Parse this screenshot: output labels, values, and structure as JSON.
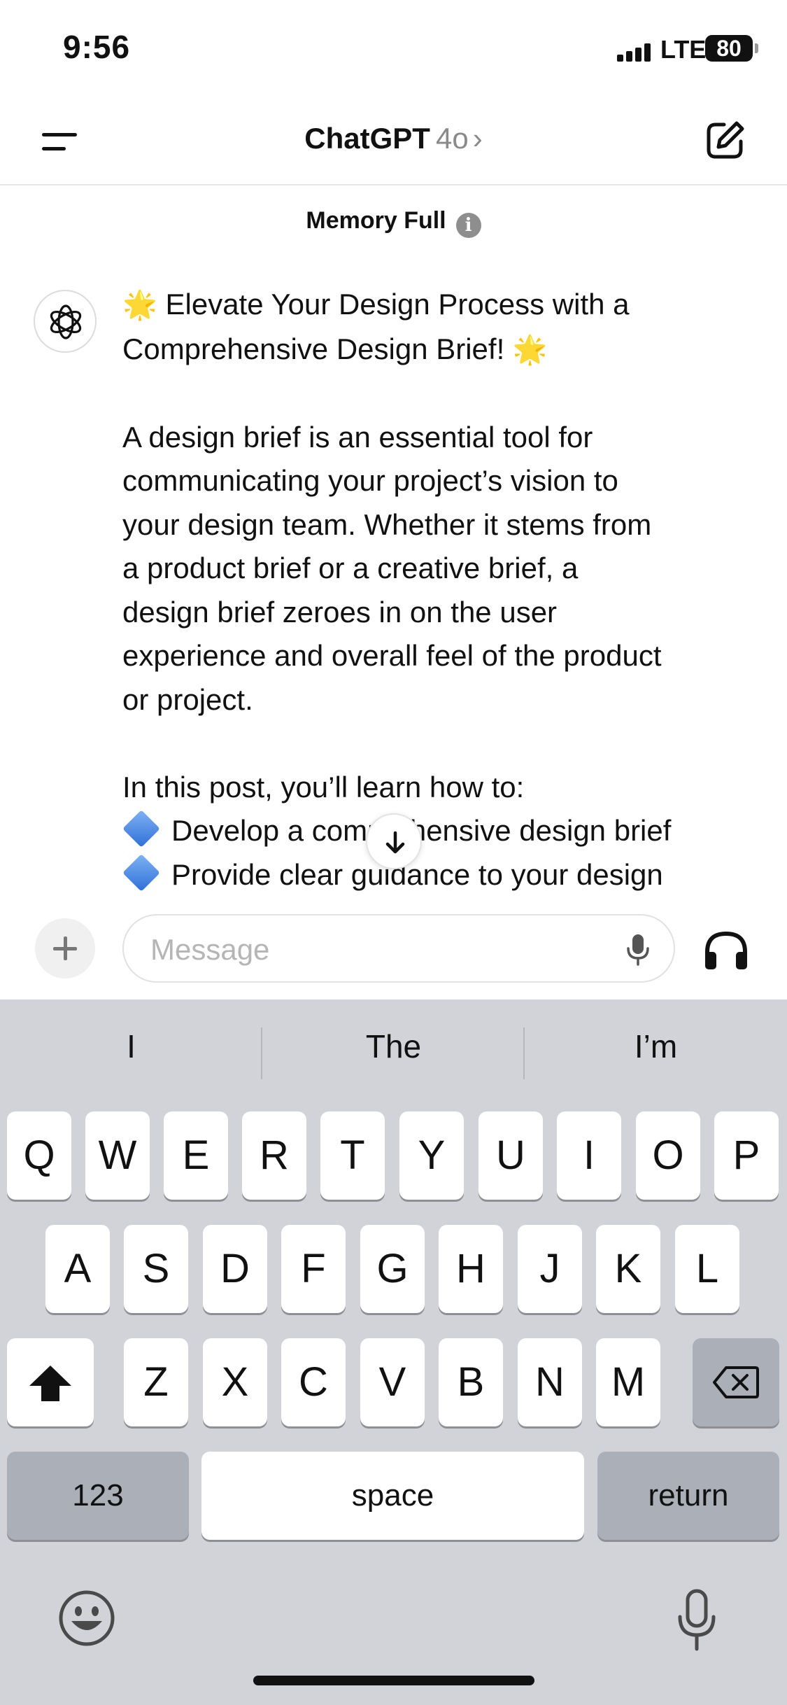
{
  "status_bar": {
    "time": "9:56",
    "network": "LTE",
    "battery": "80"
  },
  "header": {
    "title": "ChatGPT",
    "model": "4o",
    "chevron": "›"
  },
  "banner": {
    "text": "Memory Full",
    "info_icon": "i"
  },
  "message": {
    "title_line1": "Elevate Your Design Process with a",
    "title_line2": "Comprehensive Design Brief!",
    "star_emoji": "🌟",
    "paragraph": [
      "A design brief is an essential tool for",
      "communicating your project’s vision to",
      "your design team. Whether it stems from",
      "a product brief or a creative brief, a",
      "design brief zeroes in on the user",
      "experience and overall feel of the product",
      "or project."
    ],
    "learn_intro": "In this post, you’ll learn how to:",
    "bullets": [
      "Develop a comprehensive design brief",
      "Provide clear guidance to your design"
    ]
  },
  "composer": {
    "placeholder": "Message"
  },
  "keyboard": {
    "suggestions": [
      "I",
      "The",
      "I’m"
    ],
    "row1": [
      "Q",
      "W",
      "E",
      "R",
      "T",
      "Y",
      "U",
      "I",
      "O",
      "P"
    ],
    "row2": [
      "A",
      "S",
      "D",
      "F",
      "G",
      "H",
      "J",
      "K",
      "L"
    ],
    "row3": [
      "Z",
      "X",
      "C",
      "V",
      "B",
      "N",
      "M"
    ],
    "numbers_label": "123",
    "space_label": "space",
    "return_label": "return"
  },
  "icons": {
    "menu": "menu-icon",
    "compose": "compose-icon",
    "info": "info-icon",
    "avatar": "openai-logo-icon",
    "scroll": "arrow-down-icon",
    "plus": "plus-icon",
    "mic": "microphone-icon",
    "voice": "headphones-icon",
    "shift": "shift-icon",
    "delete": "backspace-icon",
    "emoji": "emoji-icon",
    "dictation": "dictation-icon"
  },
  "colors": {
    "keyboard_bg": "#d1d3d9",
    "key": "#ffffff",
    "key_dark": "#abafb8",
    "muted_text": "#8a8a8a"
  }
}
